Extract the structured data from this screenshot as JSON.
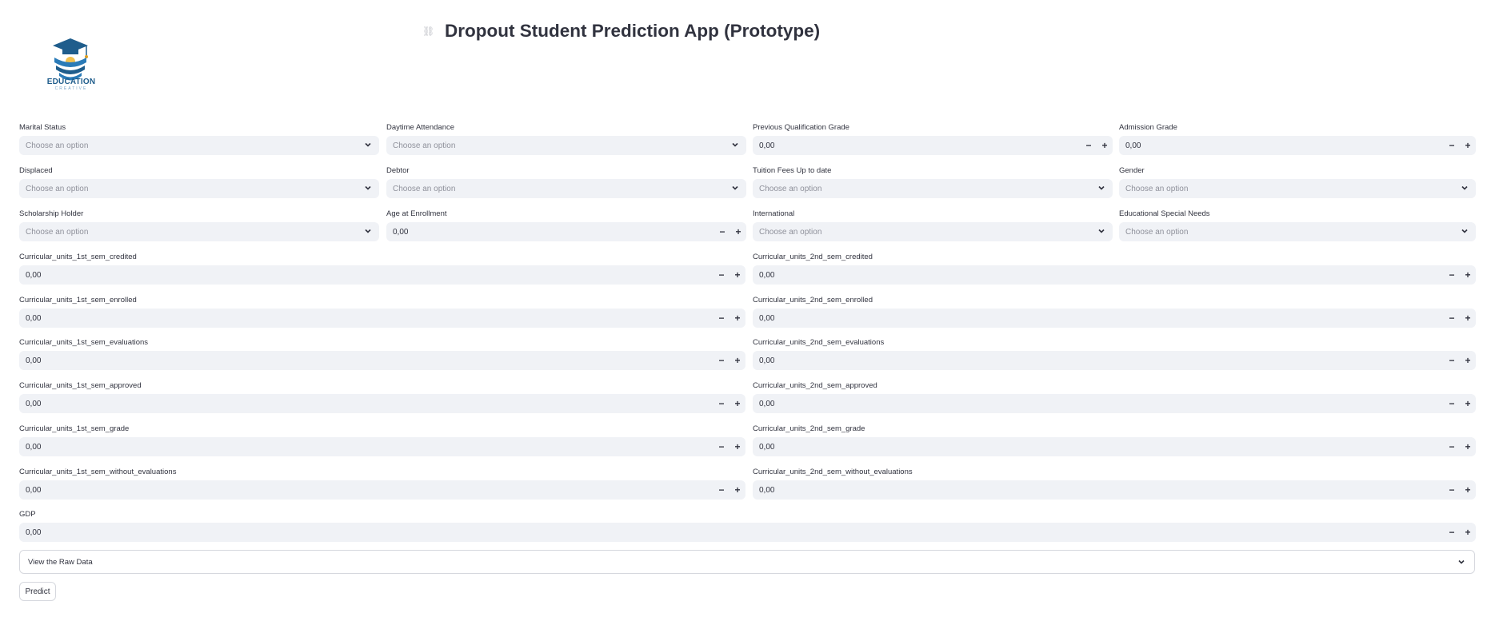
{
  "app": {
    "logo_text": "EDUCATION",
    "logo_subtext": "CREATIVE",
    "title": "Dropout Student Prediction App (Prototype)"
  },
  "form": {
    "select_placeholder": "Choose an option",
    "default_number": "0,00",
    "marital_status": "Marital Status",
    "daytime_attendance": "Daytime Attendance",
    "previous_qualification_grade": "Previous Qualification Grade",
    "admission_grade": "Admission Grade",
    "displaced": "Displaced",
    "debtor": "Debtor",
    "tuition_fees": "Tuition Fees Up to date",
    "gender": "Gender",
    "scholarship_holder": "Scholarship Holder",
    "age_at_enrollment": "Age at Enrollment",
    "international": "International",
    "educational_special_needs": "Educational Special Needs",
    "cu1_credited": "Curricular_units_1st_sem_credited",
    "cu2_credited": "Curricular_units_2nd_sem_credited",
    "cu1_enrolled": "Curricular_units_1st_sem_enrolled",
    "cu2_enrolled": "Curricular_units_2nd_sem_enrolled",
    "cu1_evaluations": "Curricular_units_1st_sem_evaluations",
    "cu2_evaluations": "Curricular_units_2nd_sem_evaluations",
    "cu1_approved": "Curricular_units_1st_sem_approved",
    "cu2_approved": "Curricular_units_2nd_sem_approved",
    "cu1_grade": "Curricular_units_1st_sem_grade",
    "cu2_grade": "Curricular_units_2nd_sem_grade",
    "cu1_without_eval": "Curricular_units_1st_sem_without_evaluations",
    "cu2_without_eval": "Curricular_units_2nd_sem_without_evaluations",
    "gdp": "GDP"
  },
  "expander": {
    "label": "View the Raw Data"
  },
  "actions": {
    "predict": "Predict"
  },
  "icons": {
    "logo": "graduation-cap-icon",
    "anchor": "link-icon",
    "dropdown": "chevron-down-icon",
    "minus": "minus-icon",
    "plus": "plus-icon"
  },
  "colors": {
    "input_bg": "#f0f2f6",
    "text": "#31333f",
    "logo_blue": "#1f5d8c"
  }
}
